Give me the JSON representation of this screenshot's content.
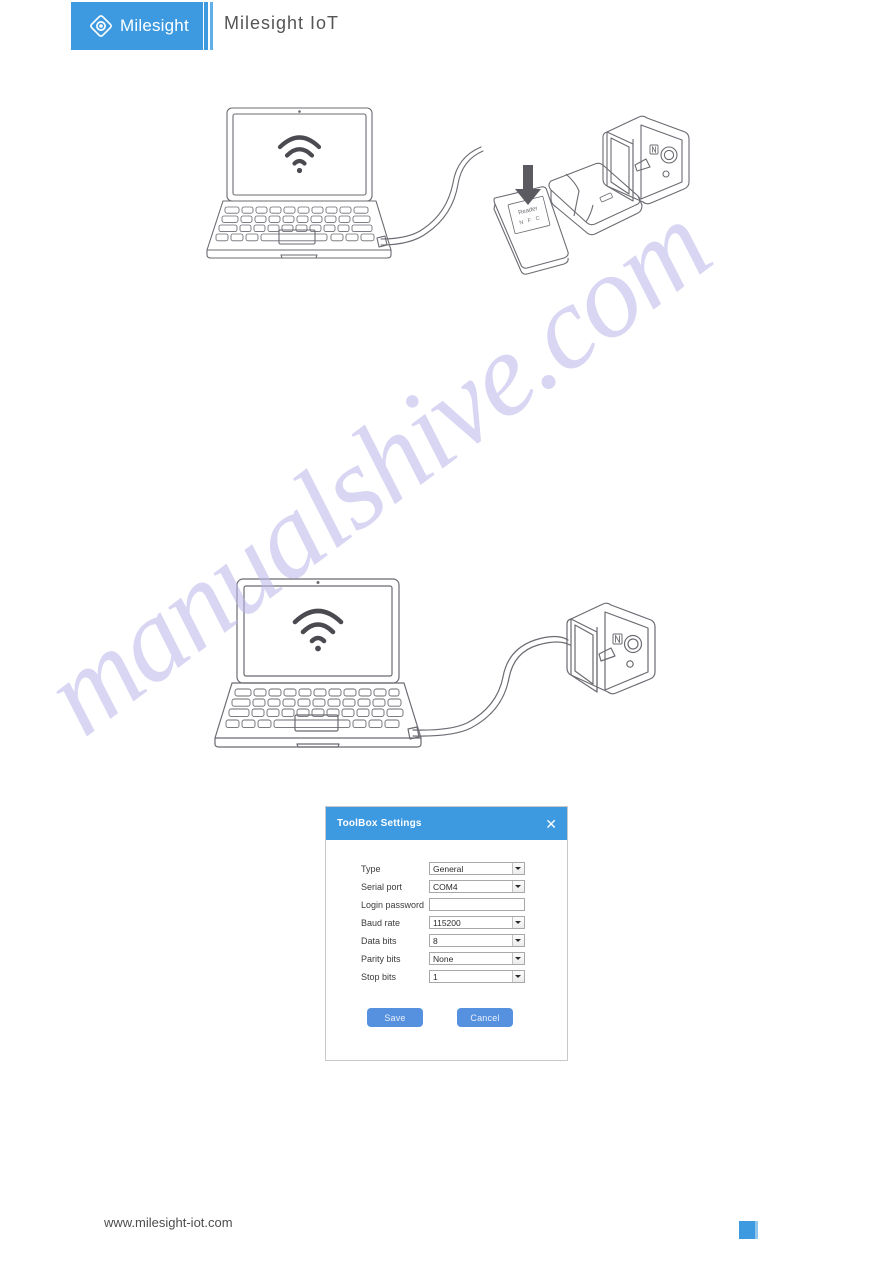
{
  "header": {
    "brand_name": "Milesight",
    "logo_icon": "milesight-diamond-eye-logo",
    "title": "Milesight IoT"
  },
  "watermark": {
    "text": "manualshive.com"
  },
  "illustrations": [
    {
      "name": "laptop-nfc-reader-device",
      "elements": {
        "laptop_screen_icon": "wifi-icon",
        "card_label_line1": "Reader",
        "card_label_line2": "N F C",
        "arrow_icon": "down-arrow-icon",
        "device_nfc_icon": "nfc-icon"
      }
    },
    {
      "name": "laptop-usb-device",
      "elements": {
        "laptop_screen_icon": "wifi-icon",
        "device_nfc_icon": "nfc-icon"
      }
    }
  ],
  "dialog": {
    "title": "ToolBox Settings",
    "close_icon": "close-icon",
    "fields": [
      {
        "label": "Type",
        "value": "General",
        "control": "select"
      },
      {
        "label": "Serial port",
        "value": "COM4",
        "control": "select"
      },
      {
        "label": "Login password",
        "value": "",
        "control": "text"
      },
      {
        "label": "Baud rate",
        "value": "115200",
        "control": "select"
      },
      {
        "label": "Data bits",
        "value": "8",
        "control": "select"
      },
      {
        "label": "Parity bits",
        "value": "None",
        "control": "select"
      },
      {
        "label": "Stop bits",
        "value": "1",
        "control": "select"
      }
    ],
    "save_label": "Save",
    "cancel_label": "Cancel"
  },
  "footer": {
    "url": "www.milesight-iot.com"
  },
  "colors": {
    "brand_blue": "#3d9ae0",
    "button_blue": "#5691e0",
    "watermark_purple": "#b9b6e8"
  }
}
